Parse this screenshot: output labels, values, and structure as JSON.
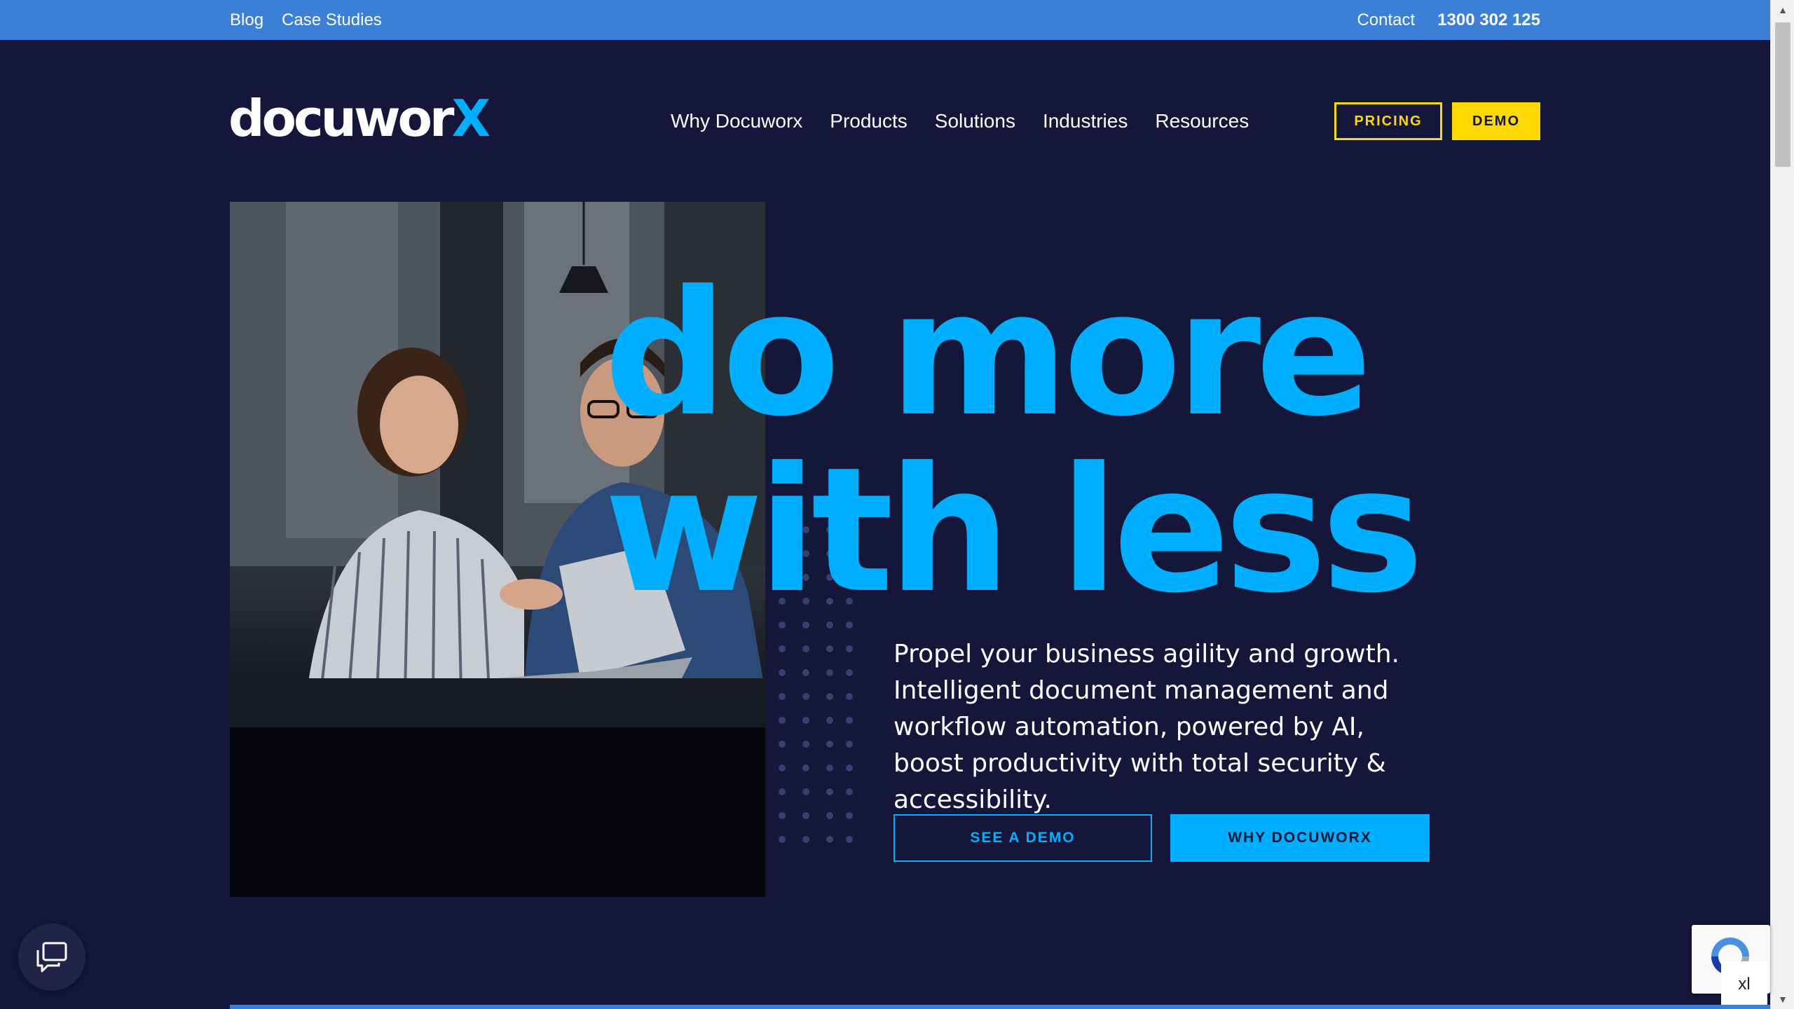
{
  "utility_bar": {
    "links": [
      "Blog",
      "Case Studies"
    ],
    "contact": "Contact",
    "phone": "1300 302 125"
  },
  "header": {
    "logo_main": "docuwor",
    "logo_accent": "X",
    "nav": [
      "Why Docuworx",
      "Products",
      "Solutions",
      "Industries",
      "Resources"
    ],
    "pricing_label": "PRICING",
    "demo_label": "DEMO"
  },
  "hero": {
    "headline_line1": "do more",
    "headline_line2": "with less",
    "body": "Propel your business agility and growth. Intelligent document management and workflow automation, powered by AI, boost productivity with total security & accessibility.",
    "see_demo_label": "SEE A DEMO",
    "why_label": "WHY DOCUWORX"
  },
  "widgets": {
    "chat_icon": "chat-bubbles-icon",
    "recaptcha_icon": "recaptcha-icon",
    "badge_label": "xl"
  },
  "colors": {
    "background": "#14163a",
    "utility_bar": "#3b7fd6",
    "accent_blue": "#00aeff",
    "accent_yellow": "#ffd900"
  }
}
